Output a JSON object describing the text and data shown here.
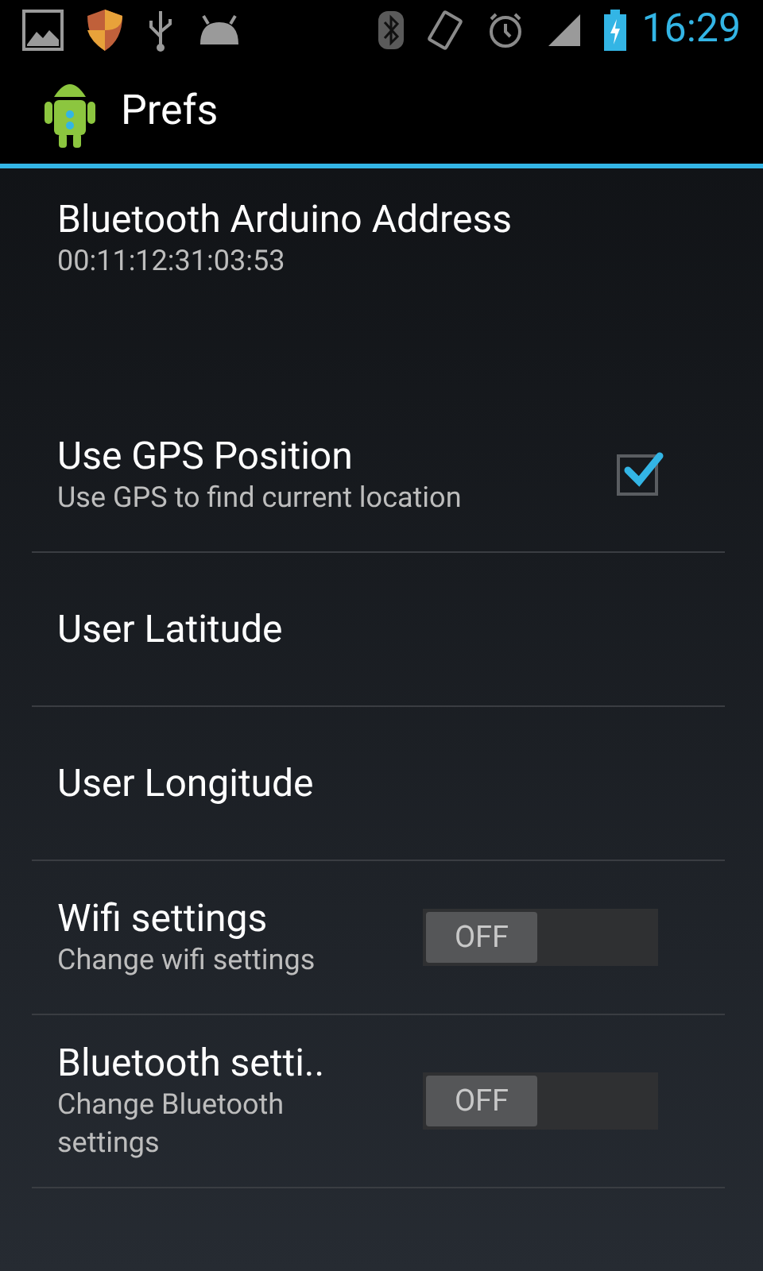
{
  "status_bar": {
    "time": "16:29"
  },
  "action_bar": {
    "title": "Prefs"
  },
  "preferences": [
    {
      "kind": "text",
      "title": "Bluetooth Arduino Address",
      "summary": "00:11:12:31:03:53"
    },
    {
      "kind": "checkbox",
      "title": "Use GPS Position",
      "summary": "Use GPS to find current location",
      "checked": true
    },
    {
      "kind": "text",
      "title": "User Latitude"
    },
    {
      "kind": "text",
      "title": "User Longitude"
    },
    {
      "kind": "switch",
      "title": "Wifi settings",
      "summary": "Change wifi settings",
      "on": false,
      "switch_label": "OFF"
    },
    {
      "kind": "switch",
      "title": "Bluetooth setti..",
      "summary": "Change Bluetooth settings",
      "on": false,
      "switch_label": "OFF"
    }
  ]
}
